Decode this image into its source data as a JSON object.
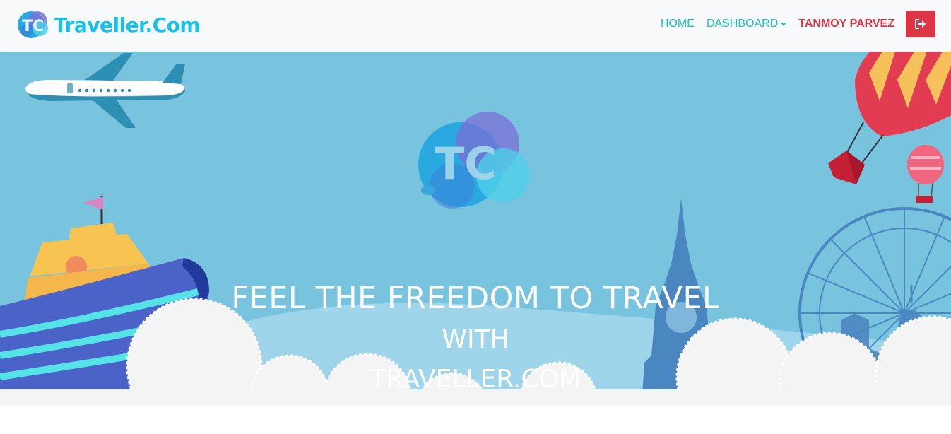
{
  "brand": {
    "name": "Traveller.Com",
    "logo_icon": "tc-logo-icon"
  },
  "nav": {
    "home": "HOME",
    "dashboard": "DASHBOARD",
    "user": "TANMOY PARVEZ",
    "logout_icon": "sign-out-icon"
  },
  "hero": {
    "line1": "FEEL THE FREEDOM TO TRAVEL",
    "line2": "WITH",
    "line3": "TRAVELLER.COM"
  },
  "colors": {
    "brand": "#17c1e8",
    "nav_link": "#1ec0c6",
    "user": "#dc3545",
    "logout_button": "#dc3545",
    "hero_sky": "#78c4df"
  }
}
